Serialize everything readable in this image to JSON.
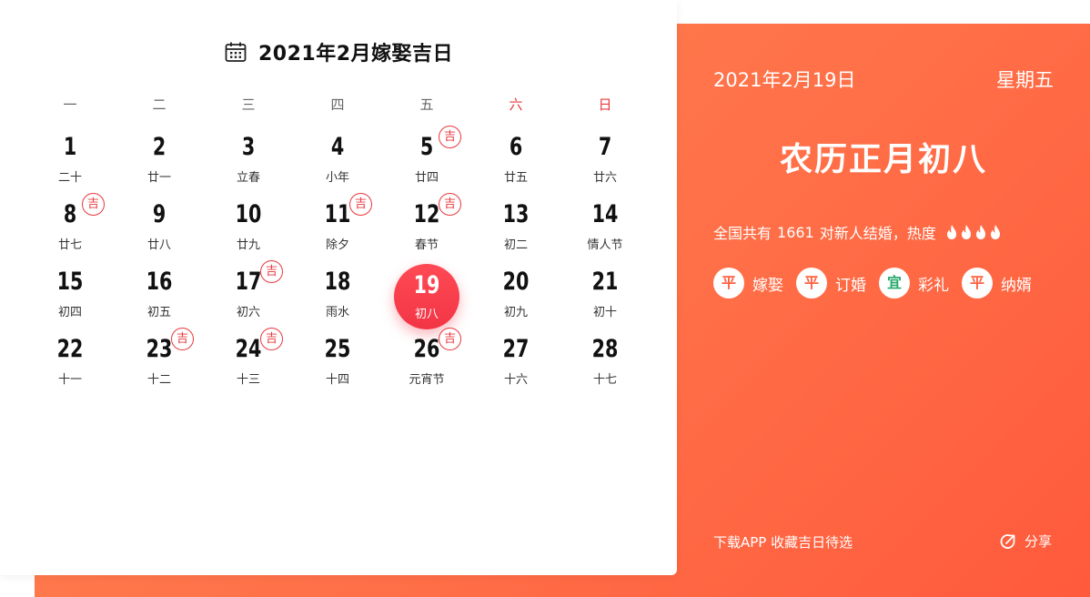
{
  "calendar": {
    "title": "2021年2月嫁娶吉日",
    "weekdays": [
      "一",
      "二",
      "三",
      "四",
      "五",
      "六",
      "日"
    ],
    "weeks": [
      [
        {
          "day": "1",
          "lunar": "二十",
          "ji": false,
          "selected": false
        },
        {
          "day": "2",
          "lunar": "廿一",
          "ji": false,
          "selected": false
        },
        {
          "day": "3",
          "lunar": "立春",
          "ji": false,
          "selected": false
        },
        {
          "day": "4",
          "lunar": "小年",
          "ji": false,
          "selected": false
        },
        {
          "day": "5",
          "lunar": "廿四",
          "ji": true,
          "selected": false
        },
        {
          "day": "6",
          "lunar": "廿五",
          "ji": false,
          "selected": false
        },
        {
          "day": "7",
          "lunar": "廿六",
          "ji": false,
          "selected": false
        }
      ],
      [
        {
          "day": "8",
          "lunar": "廿七",
          "ji": true,
          "selected": false
        },
        {
          "day": "9",
          "lunar": "廿八",
          "ji": false,
          "selected": false
        },
        {
          "day": "10",
          "lunar": "廿九",
          "ji": false,
          "selected": false
        },
        {
          "day": "11",
          "lunar": "除夕",
          "ji": true,
          "selected": false
        },
        {
          "day": "12",
          "lunar": "春节",
          "ji": true,
          "selected": false
        },
        {
          "day": "13",
          "lunar": "初二",
          "ji": false,
          "selected": false
        },
        {
          "day": "14",
          "lunar": "情人节",
          "ji": false,
          "selected": false
        }
      ],
      [
        {
          "day": "15",
          "lunar": "初四",
          "ji": false,
          "selected": false
        },
        {
          "day": "16",
          "lunar": "初五",
          "ji": false,
          "selected": false
        },
        {
          "day": "17",
          "lunar": "初六",
          "ji": true,
          "selected": false
        },
        {
          "day": "18",
          "lunar": "雨水",
          "ji": false,
          "selected": false
        },
        {
          "day": "19",
          "lunar": "初八",
          "ji": false,
          "selected": true
        },
        {
          "day": "20",
          "lunar": "初九",
          "ji": false,
          "selected": false
        },
        {
          "day": "21",
          "lunar": "初十",
          "ji": false,
          "selected": false
        }
      ],
      [
        {
          "day": "22",
          "lunar": "十一",
          "ji": false,
          "selected": false
        },
        {
          "day": "23",
          "lunar": "十二",
          "ji": true,
          "selected": false
        },
        {
          "day": "24",
          "lunar": "十三",
          "ji": true,
          "selected": false
        },
        {
          "day": "25",
          "lunar": "十四",
          "ji": false,
          "selected": false
        },
        {
          "day": "26",
          "lunar": "元宵节",
          "ji": true,
          "selected": false
        },
        {
          "day": "27",
          "lunar": "十六",
          "ji": false,
          "selected": false
        },
        {
          "day": "28",
          "lunar": "十七",
          "ji": false,
          "selected": false
        }
      ]
    ],
    "ji_label": "吉",
    "calendar_icon": "calendar-icon"
  },
  "panel": {
    "date": "2021年2月19日",
    "weekday": "星期五",
    "lunar_date": "农历正月初八",
    "stats_prefix": "全国共有",
    "couples_count": "1661",
    "stats_suffix": "对新人结婚，热度",
    "heat_level": 4,
    "tags": [
      {
        "badge": "平",
        "label": "嫁娶",
        "good": false
      },
      {
        "badge": "平",
        "label": "订婚",
        "good": false
      },
      {
        "badge": "宜",
        "label": "彩礼",
        "good": true
      },
      {
        "badge": "平",
        "label": "纳婿",
        "good": false
      }
    ],
    "download_text": "下载APP 收藏吉日待选",
    "share_label": "分享"
  },
  "colors": {
    "accent_red": "#e8383d",
    "selected_red": "#f23545",
    "panel_orange": "#ff7048",
    "good_green": "#27a86a"
  }
}
